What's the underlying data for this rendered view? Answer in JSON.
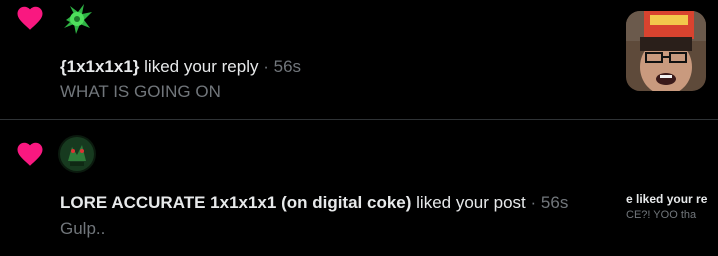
{
  "colors": {
    "background": "#000000",
    "heart": "#f91880",
    "text_primary": "#e7e9ea",
    "text_secondary": "#71767b",
    "divider": "#2f3336"
  },
  "notifications": [
    {
      "icon": "heart-icon",
      "avatar": "green-splatter-avatar",
      "user_name": "{1x1x1x1}",
      "action": "liked your reply",
      "separator": "·",
      "time": "56s",
      "content_preview": "WHAT IS GOING ON",
      "media": "reply-media-thumbnail"
    },
    {
      "icon": "heart-icon",
      "avatar": "dark-green-avatar",
      "user_name": "LORE ACCURATE 1x1x1x1 (on digital coke)",
      "action": "liked your post",
      "separator": "·",
      "time": "56s",
      "content_preview": "Gulp..",
      "preview_card": {
        "line_1": "e liked your re",
        "line_2": "CE?! YOO tha"
      }
    }
  ]
}
